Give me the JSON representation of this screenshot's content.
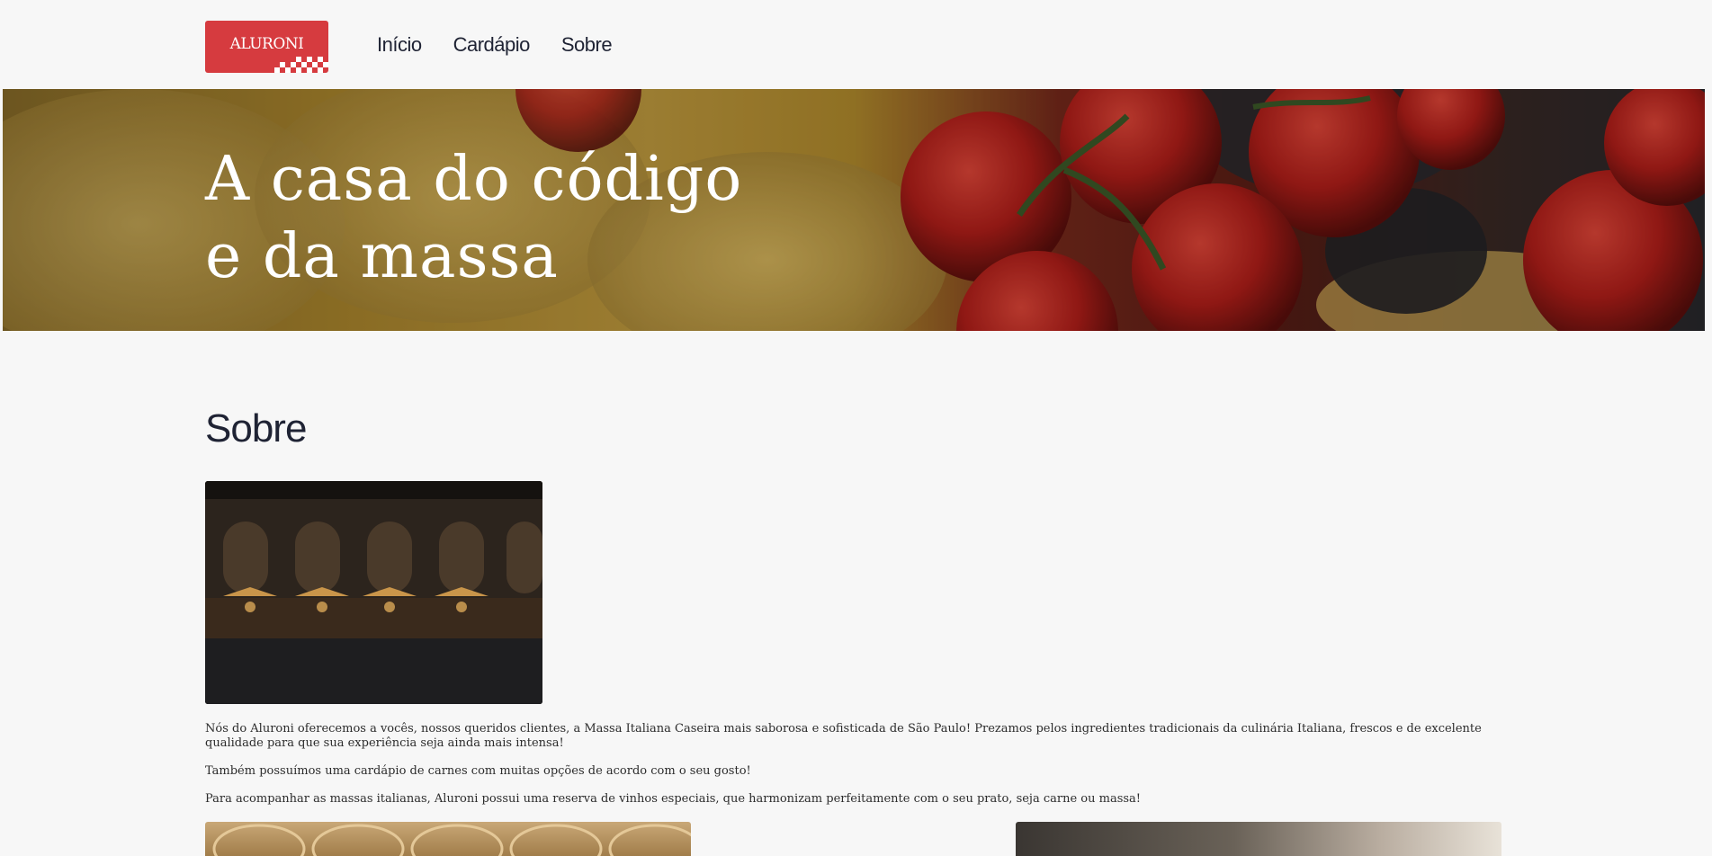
{
  "header": {
    "logo_text": "ALURONI",
    "nav": [
      {
        "label": "Início"
      },
      {
        "label": "Cardápio"
      },
      {
        "label": "Sobre"
      }
    ]
  },
  "hero": {
    "title_line1": "A casa do código",
    "title_line2": "e da massa"
  },
  "about": {
    "title": "Sobre",
    "paragraphs": [
      "Nós do Aluroni oferecemos a vocês, nossos queridos clientes, a Massa Italiana Caseira mais saborosa e sofisticada de São Paulo! Prezamos pelos ingredientes tradicionais da culinária Italiana, frescos e de excelente qualidade para que sua experiência seja ainda mais intensa!",
      "Também possuímos uma cardápio de carnes com muitas opções de acordo com o seu gosto!",
      "Para acompanhar as massas italianas, Aluroni possui uma reserva de vinhos especiais, que harmonizam perfeitamente com o seu prato, seja carne ou massa!"
    ]
  },
  "colors": {
    "brand_red": "#d63b3f",
    "text_dark": "#1f2334",
    "background": "#f7f7f7"
  }
}
